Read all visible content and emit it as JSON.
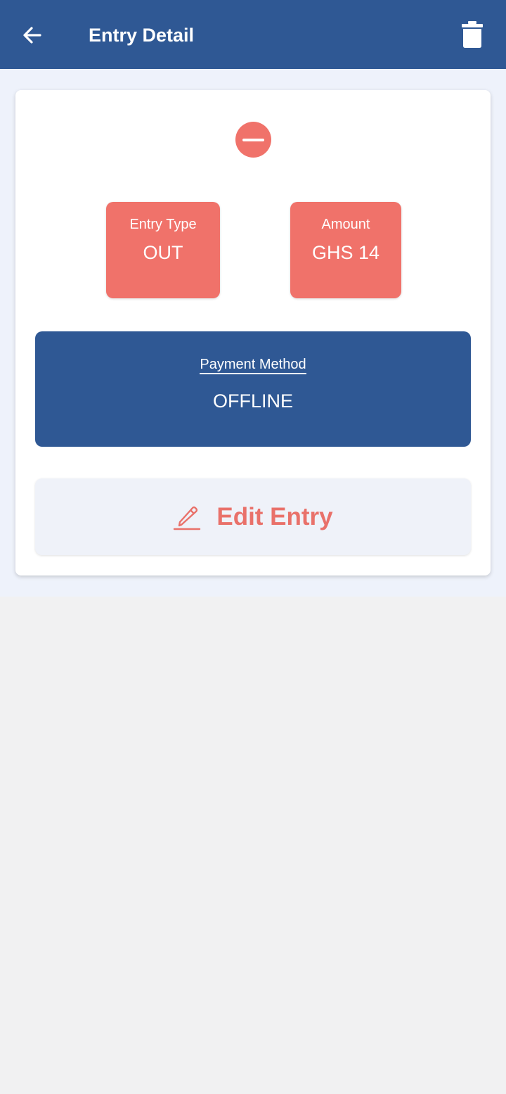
{
  "header": {
    "title": "Entry Detail",
    "back_icon": "arrow-left-icon",
    "delete_icon": "trash-icon"
  },
  "entry": {
    "status_icon": "minus-circle-icon",
    "type_label": "Entry Type",
    "type_value": "OUT",
    "amount_label": "Amount",
    "amount_value": "GHS 14",
    "payment_label": "Payment Method",
    "payment_value": "OFFLINE"
  },
  "actions": {
    "edit_icon": "pencil-icon",
    "edit_label": "Edit Entry"
  },
  "colors": {
    "primary": "#2f5894",
    "accent_red": "#f0726a",
    "background": "#eef2fb"
  }
}
